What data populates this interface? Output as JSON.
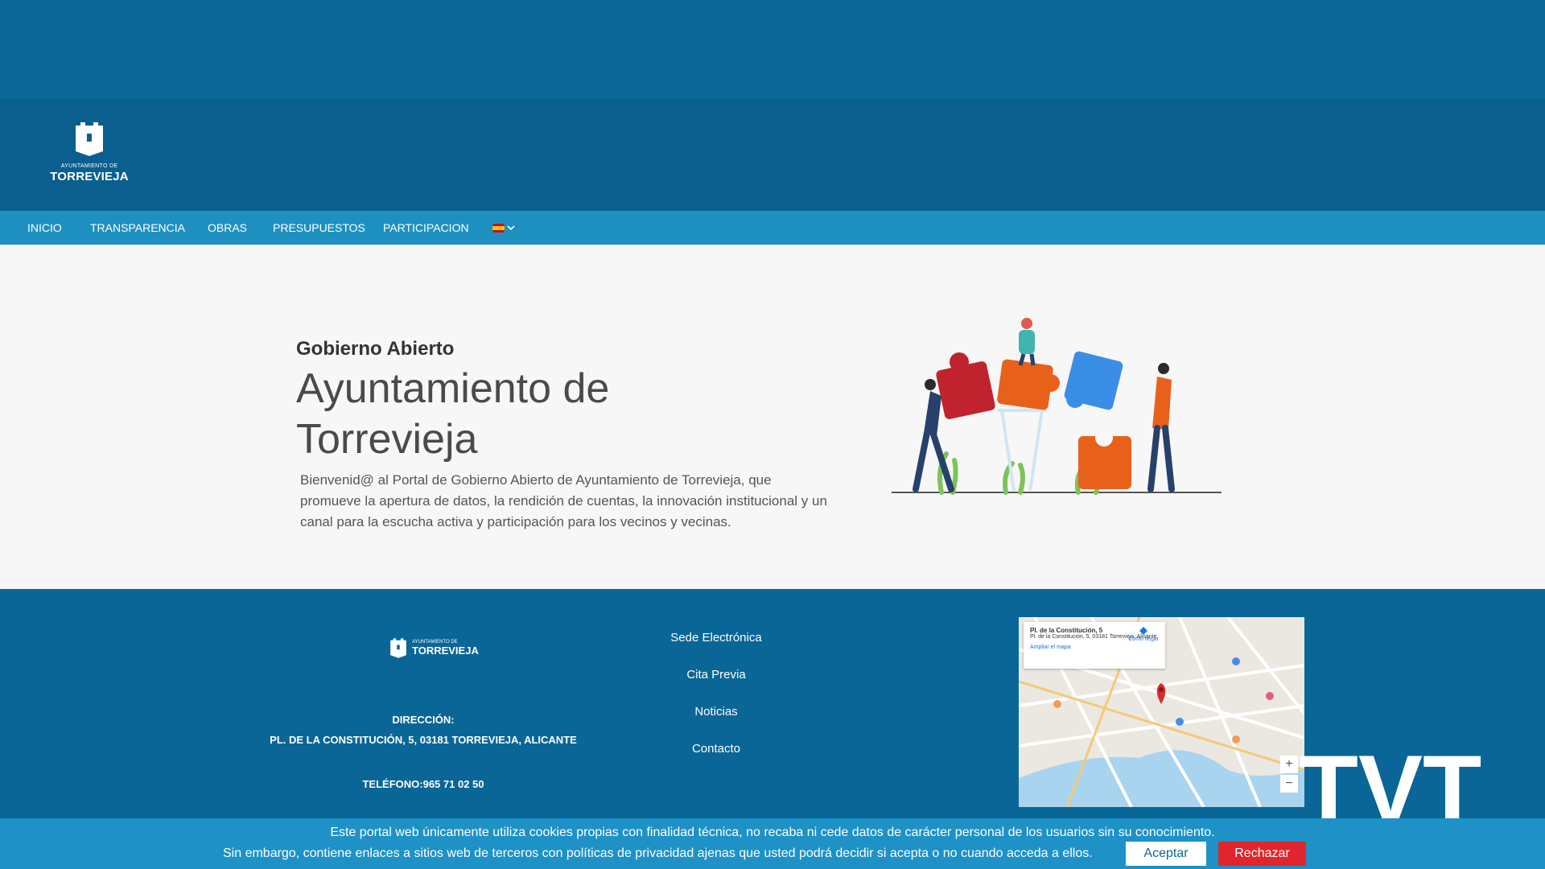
{
  "header": {
    "logo_small": "AYUNTAMIENTO DE",
    "logo_big": "TORREVIEJA"
  },
  "nav": {
    "items": [
      {
        "label": "INICIO"
      },
      {
        "label": "TRANSPARENCIA"
      },
      {
        "label": "OBRAS"
      },
      {
        "label": "PRESUPUESTOS"
      },
      {
        "label": "PARTICIPACION"
      }
    ],
    "language_icon": "spain-flag-icon"
  },
  "hero": {
    "kicker": "Gobierno Abierto",
    "title": "Ayuntamiento de Torrevieja",
    "description": "Bienvenid@ al Portal de Gobierno Abierto de Ayuntamiento de Torrevieja, que promueve la apertura de datos, la rendición de cuentas, la innovación institucional y un canal para la escucha activa y participación para los vecinos y vecinas."
  },
  "footer": {
    "logo_small": "AYUNTAMIENTO DE",
    "logo_big": "TORREVIEJA",
    "address_label": "DIRECCIÓN:",
    "address": "PL. DE LA CONSTITUCIÓN, 5, 03181 TORREVIEJA, ALICANTE",
    "phone": "TELÉFONO:965 71 02 50",
    "links": [
      {
        "label": "Sede Electrónica"
      },
      {
        "label": "Cita Previa"
      },
      {
        "label": "Noticias"
      },
      {
        "label": "Contacto"
      }
    ]
  },
  "map": {
    "place_title": "Pl. de la Constitución, 5",
    "place_address": "Pl. de la Constitución, 5, 03181 Torrevieja, Alicante",
    "enlarge": "Ampliar el mapa",
    "directions": "Cómo llegar",
    "zoom_in": "+",
    "zoom_out": "−"
  },
  "watermark": "TVT",
  "cookie": {
    "line1": "Este portal web únicamente utiliza cookies propias con finalidad técnica, no recaba ni cede datos de carácter personal de los usuarios sin su conocimiento.",
    "line2": "Sin embargo, contiene enlaces a sitios web de terceros con políticas de privacidad ajenas que usted podrá decidir si acepta o no cuando acceda a ellos.",
    "accept": "Aceptar",
    "reject": "Rechazar"
  },
  "colors": {
    "top_band": "#0a6798",
    "header": "#0a5f8e",
    "nav": "#1e90c0",
    "footer": "#0a6696",
    "cookie_bar": "#1e91c7",
    "reject_button": "#e0262c"
  }
}
